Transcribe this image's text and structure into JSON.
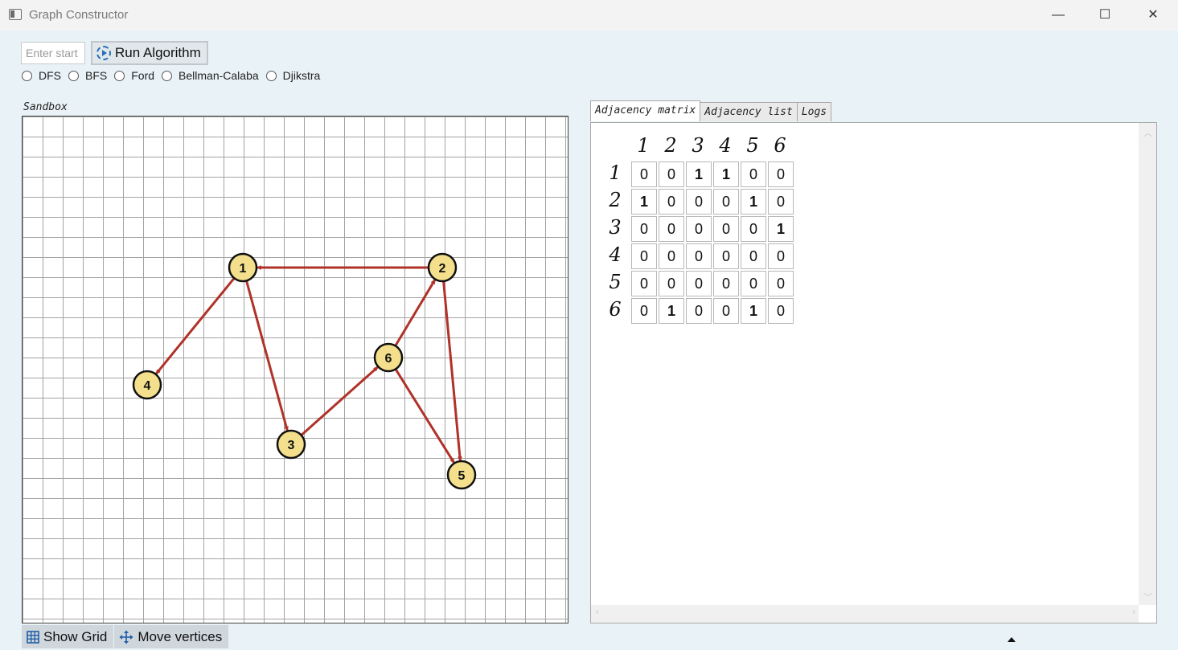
{
  "window": {
    "title": "Graph Constructor",
    "controls": {
      "minimize": "—",
      "maximize": "☐",
      "close": "✕"
    }
  },
  "toolbar": {
    "start_placeholder": "Enter start",
    "start_value": "",
    "run_label": "Run Algorithm",
    "algorithms": [
      "DFS",
      "BFS",
      "Ford",
      "Bellman-Calaba",
      "Djikstra"
    ],
    "selected_algorithm": null
  },
  "sandbox": {
    "label": "Sandbox",
    "grid_visible": true,
    "vertex_fill": "#f4e08c",
    "edge_color": "#b03228",
    "vertices": [
      {
        "id": "1"
      },
      {
        "id": "2"
      },
      {
        "id": "3"
      },
      {
        "id": "4"
      },
      {
        "id": "5"
      },
      {
        "id": "6"
      }
    ],
    "edges": [
      {
        "from": "1",
        "to": "3"
      },
      {
        "from": "1",
        "to": "4"
      },
      {
        "from": "2",
        "to": "1"
      },
      {
        "from": "2",
        "to": "5"
      },
      {
        "from": "3",
        "to": "6"
      },
      {
        "from": "6",
        "to": "2"
      },
      {
        "from": "6",
        "to": "5"
      }
    ]
  },
  "bottom_tools": {
    "show_grid_label": "Show Grid",
    "move_vertices_label": "Move vertices"
  },
  "tabs": [
    {
      "label": "Adjacency matrix",
      "active": true
    },
    {
      "label": "Adjacency list",
      "active": false
    },
    {
      "label": "Logs",
      "active": false
    }
  ],
  "matrix": {
    "headers": [
      "1",
      "2",
      "3",
      "4",
      "5",
      "6"
    ],
    "rows": [
      [
        "0",
        "0",
        "1",
        "1",
        "0",
        "0"
      ],
      [
        "1",
        "0",
        "0",
        "0",
        "1",
        "0"
      ],
      [
        "0",
        "0",
        "0",
        "0",
        "0",
        "1"
      ],
      [
        "0",
        "0",
        "0",
        "0",
        "0",
        "0"
      ],
      [
        "0",
        "0",
        "0",
        "0",
        "0",
        "0"
      ],
      [
        "0",
        "1",
        "0",
        "0",
        "1",
        "0"
      ]
    ]
  }
}
